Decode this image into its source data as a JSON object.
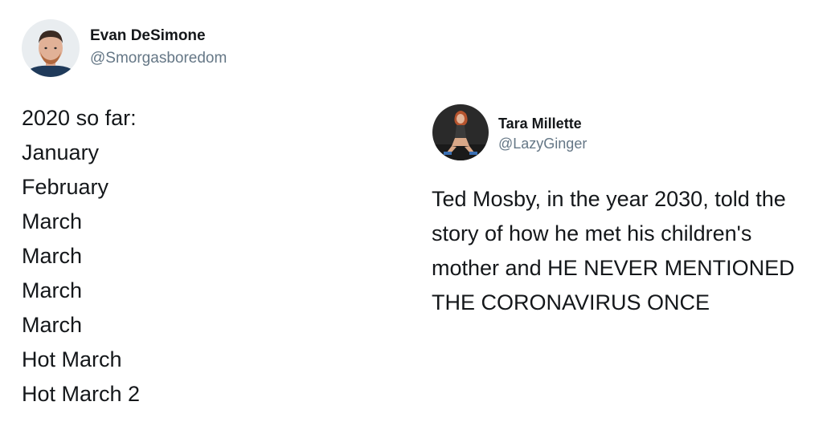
{
  "tweets": [
    {
      "author_name": "Evan DeSimone",
      "author_handle": "@Smorgasboredom",
      "avatar_icon": "profile-photo-man",
      "lines": [
        "2020 so far:",
        "January",
        "February",
        "March",
        "March",
        "March",
        "March",
        "Hot March",
        "Hot March 2"
      ]
    },
    {
      "author_name": "Tara Millette",
      "author_handle": "@LazyGinger",
      "avatar_icon": "profile-photo-woman",
      "text": "Ted Mosby, in the year 2030, told the story of how he met his children's mother and HE NEVER MENTIONED THE CORONAVIRUS ONCE"
    }
  ],
  "colors": {
    "text": "#14171a",
    "handle": "#657786",
    "background": "#ffffff"
  }
}
